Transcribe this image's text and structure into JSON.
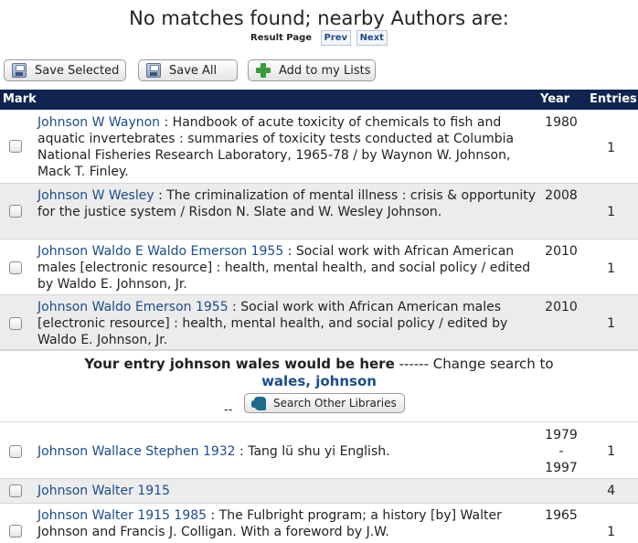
{
  "header": {
    "title": "No matches found; nearby Authors are:",
    "result_page_label": "Result Page",
    "prev_label": "Prev",
    "next_label": "Next"
  },
  "toolbar": {
    "save_selected_label": "Save Selected",
    "save_all_label": "Save All",
    "add_to_lists_label": "Add to my Lists"
  },
  "table": {
    "headers": {
      "mark": "Mark",
      "year": "Year",
      "entries": "Entries"
    },
    "rows": [
      {
        "author": "Johnson W Waynon",
        "title": " : Handbook of acute toxicity of chemicals to fish and aquatic invertebrates : summaries of toxicity tests conducted at Columbia National Fisheries Research Laboratory, 1965-78 / by Waynon W. Johnson, Mack T. Finley.",
        "year": "1980",
        "entries": "1"
      },
      {
        "author": "Johnson W Wesley",
        "title": " : The criminalization of mental illness : crisis & opportunity for the justice system / Risdon N. Slate and W. Wesley Johnson.",
        "year": "2008",
        "entries": "1"
      },
      {
        "author": "Johnson Waldo E Waldo Emerson 1955",
        "title": " : Social work with African American males [electronic resource] : health, mental health, and social policy / edited by Waldo E. Johnson, Jr.",
        "year": "2010",
        "entries": "1"
      },
      {
        "author": "Johnson Waldo Emerson 1955",
        "title": " : Social work with African American males [electronic resource] : health, mental health, and social policy / edited by Waldo E. Johnson, Jr.",
        "year": "2010",
        "entries": "1"
      },
      {
        "author": "Johnson Wallace Stephen 1932",
        "title": " : Tang lü shu yi English.",
        "year_start": "1979",
        "year_sep": "-",
        "year_end": "1997",
        "entries": "1"
      },
      {
        "author": "Johnson Walter 1915",
        "title": "",
        "year": "",
        "entries": "4"
      },
      {
        "author": "Johnson Walter 1915 1985",
        "title": " : The Fulbright program; a history [by] Walter Johnson and Francis J. Colligan. With a foreword by J.W.",
        "year": "1965",
        "entries": "1"
      }
    ]
  },
  "entry_notice": {
    "bold_text": "Your entry johnson wales would be here",
    "middle_text": " ------ Change search to",
    "link_text": "wales, johnson",
    "dashes": "--",
    "search_other_label": "Search Other Libraries"
  },
  "colors": {
    "header_bar": "#0f2450",
    "link": "#1a4d8c",
    "alt_row": "#ececec"
  },
  "icons": {
    "save_selected": "floppy-disk-icon",
    "save_all": "floppy-disk-icon",
    "add_to_lists": "green-plus-icon",
    "search_other": "michigan-map-icon"
  }
}
